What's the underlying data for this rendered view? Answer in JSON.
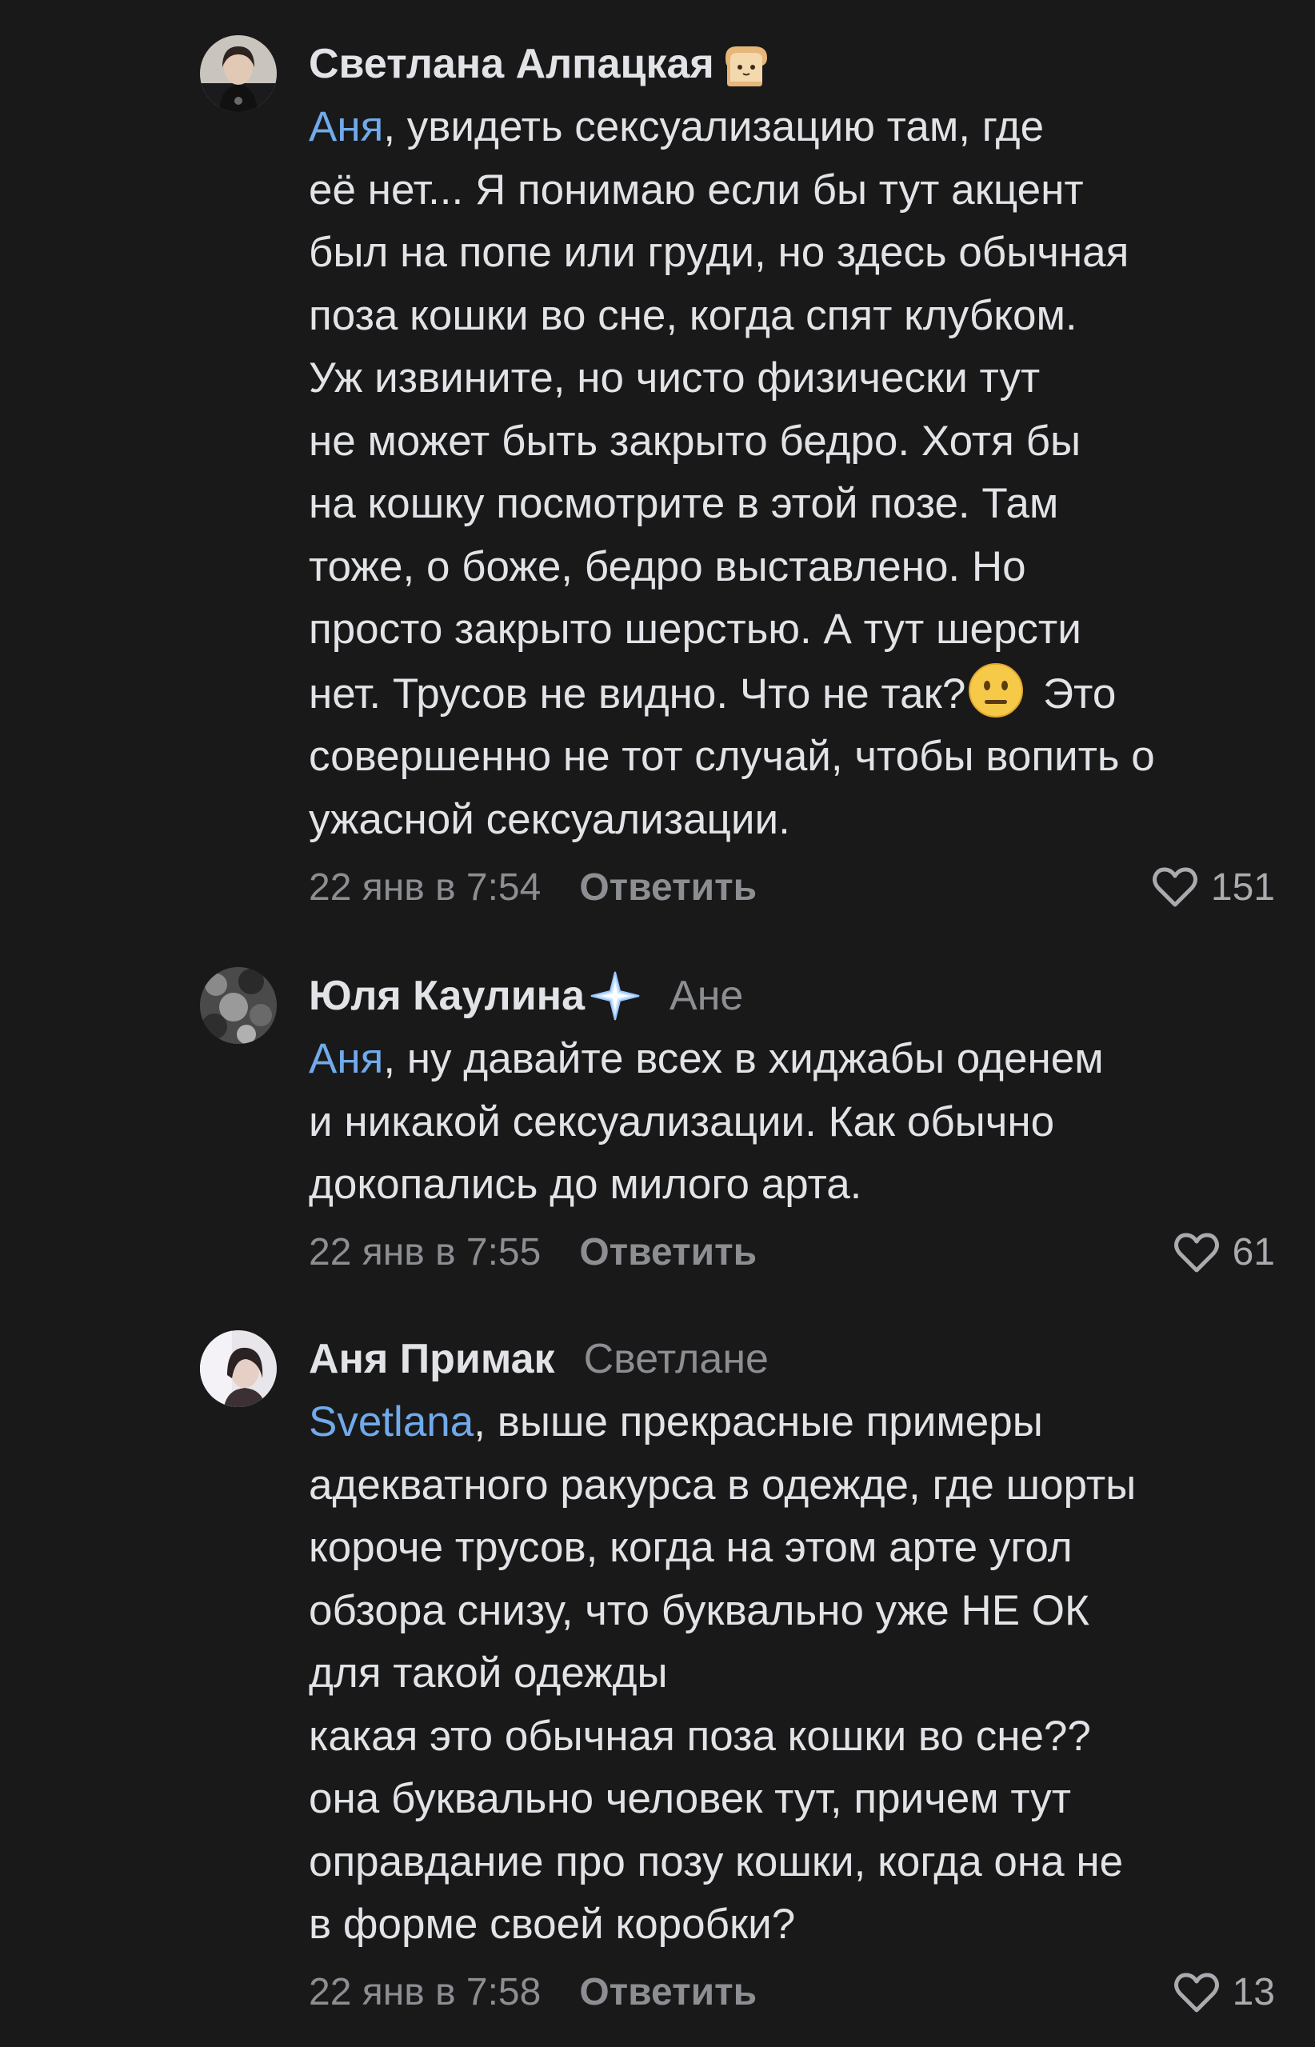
{
  "comments": [
    {
      "author": "Светлана Алпацкая",
      "badge_icon": "bread-emoji",
      "reply_to": "",
      "lines": [
        {
          "mention": "Аня",
          "text": ", увидеть сексуализацию там, где"
        },
        {
          "text": "её нет... Я понимаю если бы тут акцент"
        },
        {
          "text": "был на попе или груди, но здесь обычная"
        },
        {
          "text": "поза кошки во сне, когда спят клубком."
        },
        {
          "text": "Уж извините, но чисто физически тут"
        },
        {
          "text": "не может быть закрыто бедро. Хотя бы"
        },
        {
          "text": "на кошку посмотрите в этой позе. Там"
        },
        {
          "text": "тоже, о боже, бедро выставлено. Но"
        },
        {
          "text": "просто закрыто шерстью. А тут шерсти"
        },
        {
          "text": "нет. Трусов не видно. Что не так?",
          "emoji": "neutral-face-emoji",
          "after": " Это"
        },
        {
          "text": "совершенно не тот случай, чтобы вопить о"
        },
        {
          "text": "ужасной сексуализации."
        }
      ],
      "time": "22 янв в 7:54",
      "reply_label": "Ответить",
      "likes": "151"
    },
    {
      "author": "Юля Каулина",
      "badge_icon": "sparkle-star-icon",
      "reply_to": "Ане",
      "lines": [
        {
          "mention": "Аня",
          "text": ", ну давайте всех в хиджабы оденем"
        },
        {
          "text": "и никакой сексуализации. Как обычно"
        },
        {
          "text": "докопались до милого арта."
        }
      ],
      "time": "22 янв в 7:55",
      "reply_label": "Ответить",
      "likes": "61"
    },
    {
      "author": "Аня Примак",
      "badge_icon": "",
      "reply_to": "Светлане",
      "lines": [
        {
          "mention": "Svetlana",
          "text": ", выше прекрасные примеры"
        },
        {
          "text": "адекватного ракурса в одежде, где шорты"
        },
        {
          "text": "короче трусов, когда на этом арте угол"
        },
        {
          "text": "обзора снизу, что буквально уже НЕ ОК"
        },
        {
          "text": "для такой одежды"
        },
        {
          "text": "какая это обычная поза кошки во сне??"
        },
        {
          "text": "она буквально человек тут, причем тут"
        },
        {
          "text": "оправдание про позу кошки, когда она не"
        },
        {
          "text": "в форме своей коробки?"
        }
      ],
      "time": "22 янв в 7:58",
      "reply_label": "Ответить",
      "likes": "13"
    }
  ],
  "colors": {
    "background": "#19191a",
    "text": "#e1e3e6",
    "mention": "#71aaeb",
    "secondary": "#8c8e92"
  },
  "icons": {
    "like": "heart-outline-icon",
    "avatar": "user-avatar"
  }
}
